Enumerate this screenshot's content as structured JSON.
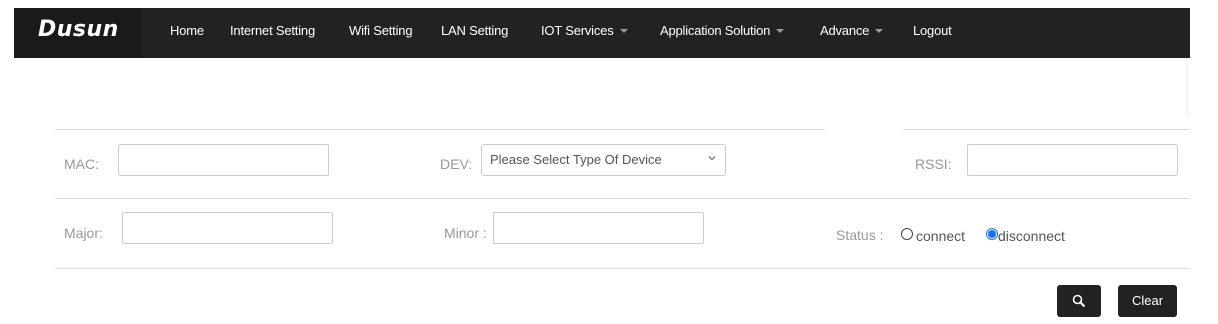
{
  "navbar": {
    "brand": "Dusun",
    "items": [
      {
        "label": "Home"
      },
      {
        "label": "Internet Setting"
      },
      {
        "label": "Wifi Setting"
      },
      {
        "label": "LAN Setting"
      },
      {
        "label": "IOT Services",
        "dropdown": true
      },
      {
        "label": "Application Solution",
        "dropdown": true
      },
      {
        "label": "Advance",
        "dropdown": true
      },
      {
        "label": "Logout"
      }
    ]
  },
  "filters": {
    "mac": {
      "label": "MAC:",
      "value": ""
    },
    "dev": {
      "label": "DEV:",
      "selected": "Please Select Type Of Device"
    },
    "rssi": {
      "label": "RSSI:",
      "value": ""
    },
    "major": {
      "label": "Major:",
      "value": ""
    },
    "minor": {
      "label": "Minor :",
      "value": ""
    },
    "status": {
      "label": "Status :",
      "options": [
        {
          "label": "connect",
          "checked": false
        },
        {
          "label": "disconnect",
          "checked": true
        }
      ]
    }
  },
  "actions": {
    "search_icon": "magnifier-icon",
    "clear_label": "Clear"
  },
  "colors": {
    "navbar_bg": "#222222",
    "accent": "#1a73e8"
  }
}
